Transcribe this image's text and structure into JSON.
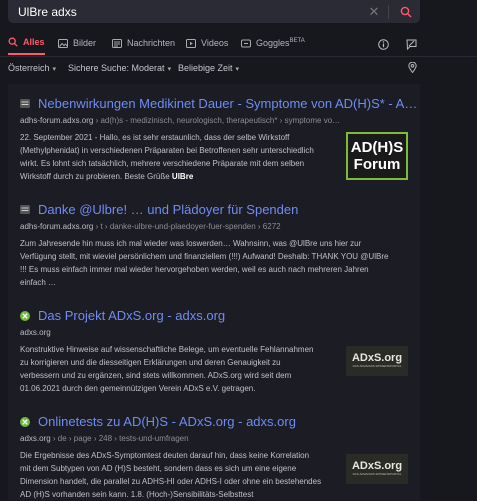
{
  "search": {
    "query": "UlBre adxs"
  },
  "tabs": [
    {
      "label": "Alles"
    },
    {
      "label": "Bilder"
    },
    {
      "label": "Nachrichten"
    },
    {
      "label": "Videos"
    },
    {
      "label": "Goggles",
      "sup": "BETA"
    }
  ],
  "filters": {
    "region": "Österreich",
    "safe": "Sichere Suche: Moderat",
    "time": "Beliebige Zeit"
  },
  "results": [
    {
      "title": "Nebenwirkungen Medikinet Dauer - Symptome von AD(H)S* - A…",
      "host": "adhs-forum.adxs.org",
      "path": " › ad(h)s - medizinisch, neurologisch, therapeutisch* › symptome vo…",
      "snippet_lines": [
        "22. September 2021 - Hallo, es ist sehr erstaunlich, dass der selbe Wirkstoff",
        "(Methylphenidat) in verschiedenen Präparaten bei Betroffenen sehr unterschiedlich",
        "wirkt. Es lohnt sich tatsächlich, mehrere verschiedene Präparate mit dem selben",
        "Wirkstoff durch zu probieren. Beste Grüße "
      ],
      "snippet_bold_tail": "UlBre",
      "thumb_line1": "AD(H)S",
      "thumb_line2": "Forum"
    },
    {
      "title": "Danke @Ulbre! … und Plädoyer für Spenden",
      "host": "adhs-forum.adxs.org",
      "path": " › t › danke-ulbre-und-plaedoyer-fuer-spenden › 6272",
      "snippet_lines": [
        "Zum Jahresende hin muss ich mal wieder was loswerden… Wahnsinn, was @UlBre uns hier zur",
        "Verfügung stellt, mit wieviel persönlichem und finanziellem (!!!) Aufwand! Deshalb: THANK YOU @UlBre",
        "!!! Es muss einfach immer mal wieder hervorgehoben werden, weil es auch nach mehreren Jahren",
        "einfach …"
      ]
    },
    {
      "title": "Das Projekt ADxS.org - adxs.org",
      "host": "adxs.org",
      "path": "",
      "snippet_lines": [
        "Konstruktive Hinweise auf wissenschaftliche Belege, um eventuelle Fehlannahmen",
        "zu korrigieren und die diesseitigen Erklärungen und deren Genauigkeit zu",
        "verbessern und zu ergänzen, sind stets willkommen. ADxS.org wird seit dem",
        "01.06.2021 durch den gemeinnützigen Verein ADxS e.V. getragen."
      ],
      "thumb_logo": "ADxS.org",
      "thumb_sub": "DAS ADHS/ADS-WISSENSPORTAL"
    },
    {
      "title": "Onlinetests zu AD(H)S - ADxS.org - adxs.org",
      "host": "adxs.org",
      "path": " › de › page › 248 › tests-und-umfragen",
      "snippet_lines": [
        "Die Ergebnisse des ADxS-Symptomtest deuten darauf hin, dass keine Korrelation",
        "mit dem Subtypen von AD (H)S besteht, sondern dass es sich um eine eigene",
        "Dimension handelt, die parallel zu ADHS-HI oder ADHS-I oder ohne ein bestehendes",
        "AD (H)S vorhanden sein kann. 1.8. (Hoch-)Sensibilitäts-Selbsttest"
      ],
      "thumb_logo": "ADxS.org",
      "thumb_sub": "DAS ADHS/ADS-WISSENSPORTAL"
    }
  ]
}
